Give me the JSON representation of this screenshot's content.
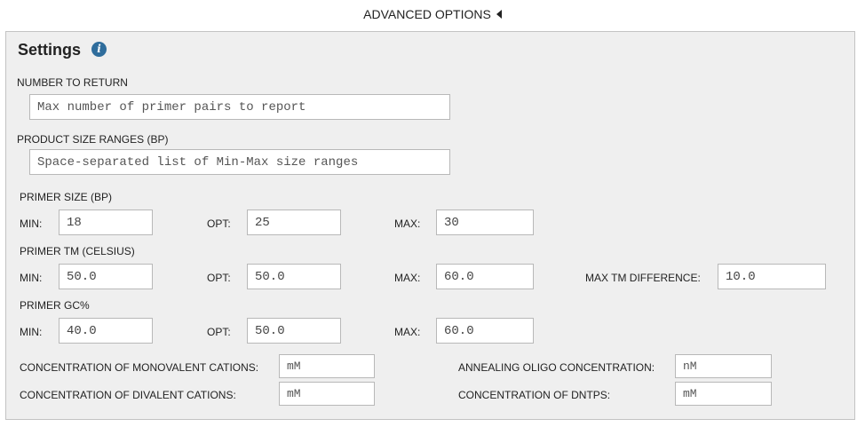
{
  "advanced_toggle": "ADVANCED OPTIONS",
  "settings": {
    "title": "Settings",
    "info_icon": "info-icon",
    "number_to_return": {
      "label": "NUMBER TO RETURN",
      "placeholder": "Max number of primer pairs to report"
    },
    "product_size_ranges": {
      "label": "PRODUCT SIZE RANGES (BP)",
      "placeholder": "Space-separated list of Min-Max size ranges"
    },
    "primer_size": {
      "label": "PRIMER SIZE (BP)",
      "min_label": "MIN:",
      "min": "18",
      "opt_label": "OPT:",
      "opt": "25",
      "max_label": "MAX:",
      "max": "30"
    },
    "primer_tm": {
      "label": "PRIMER TM (CELSIUS)",
      "min_label": "MIN:",
      "min": "50.0",
      "opt_label": "OPT:",
      "opt": "50.0",
      "max_label": "MAX:",
      "max": "60.0",
      "diff_label": "MAX TM DIFFERENCE:",
      "diff": "10.0"
    },
    "primer_gc": {
      "label": "PRIMER GC%",
      "min_label": "MIN:",
      "min": "40.0",
      "opt_label": "OPT:",
      "opt": "50.0",
      "max_label": "MAX:",
      "max": "60.0"
    },
    "concentrations": {
      "monovalent_label": "CONCENTRATION OF MONOVALENT CATIONS:",
      "monovalent_placeholder": "mM",
      "divalent_label": "CONCENTRATION OF DIVALENT CATIONS:",
      "divalent_placeholder": "mM",
      "annealing_label": "ANNEALING OLIGO CONCENTRATION:",
      "annealing_placeholder": "nM",
      "dntps_label": "CONCENTRATION OF DNTPS:",
      "dntps_placeholder": "mM"
    }
  }
}
